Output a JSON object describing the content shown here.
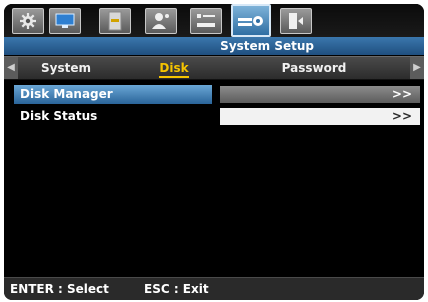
{
  "icon_tabs": [
    {
      "name": "settings-gear-icon"
    },
    {
      "name": "display-monitor-icon"
    },
    {
      "name": "record-hdd-icon"
    },
    {
      "name": "user-icon"
    },
    {
      "name": "network-icon"
    },
    {
      "name": "system-setup-icon",
      "active": true
    },
    {
      "name": "exit-door-icon"
    }
  ],
  "title": "System Setup",
  "tabs": [
    {
      "label": "System"
    },
    {
      "label": "Disk"
    },
    {
      "label": "Password"
    }
  ],
  "active_tab": "Disk",
  "menu": [
    {
      "label": "Disk Manager",
      "value": ">>",
      "selected": true
    },
    {
      "label": "Disk Status",
      "value": ">>",
      "selected": false
    }
  ],
  "footer": {
    "enter": "ENTER : Select",
    "esc": "ESC : Exit"
  },
  "colors": {
    "accent": "#2f6ea3",
    "active_tab_text": "#f5c400"
  }
}
